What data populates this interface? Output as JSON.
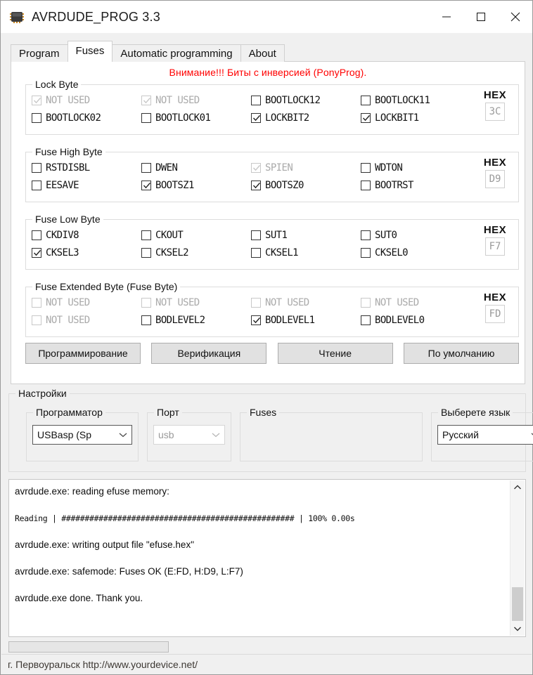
{
  "window": {
    "title": "AVRDUDE_PROG 3.3",
    "icon": "chip-icon",
    "minimize": "minimize-icon",
    "maximize": "maximize-icon",
    "close": "close-icon"
  },
  "tabs": [
    {
      "label": "Program",
      "active": false
    },
    {
      "label": "Fuses",
      "active": true
    },
    {
      "label": "Automatic programming",
      "active": false
    },
    {
      "label": "About",
      "active": false
    }
  ],
  "warning": {
    "text": "Внимание!!! Биты с инверсией (PonyProg).",
    "color": "#ff0000"
  },
  "fuse_groups": [
    {
      "title": "Lock Byte",
      "hex_label": "HEX",
      "hex_value": "3C",
      "rows": [
        [
          {
            "label": "NOT USED",
            "checked": true,
            "disabled": true
          },
          {
            "label": "NOT USED",
            "checked": true,
            "disabled": true
          },
          {
            "label": "BOOTLOCK12",
            "checked": false,
            "disabled": false
          },
          {
            "label": "BOOTLOCK11",
            "checked": false,
            "disabled": false
          }
        ],
        [
          {
            "label": "BOOTLOCK02",
            "checked": false,
            "disabled": false
          },
          {
            "label": "BOOTLOCK01",
            "checked": false,
            "disabled": false
          },
          {
            "label": "LOCKBIT2",
            "checked": true,
            "disabled": false
          },
          {
            "label": "LOCKBIT1",
            "checked": true,
            "disabled": false
          }
        ]
      ]
    },
    {
      "title": "Fuse High Byte",
      "hex_label": "HEX",
      "hex_value": "D9",
      "rows": [
        [
          {
            "label": "RSTDISBL",
            "checked": false,
            "disabled": false
          },
          {
            "label": "DWEN",
            "checked": false,
            "disabled": false
          },
          {
            "label": "SPIEN",
            "checked": true,
            "disabled": true
          },
          {
            "label": "WDTON",
            "checked": false,
            "disabled": false
          }
        ],
        [
          {
            "label": "EESAVE",
            "checked": false,
            "disabled": false
          },
          {
            "label": "BOOTSZ1",
            "checked": true,
            "disabled": false
          },
          {
            "label": "BOOTSZ0",
            "checked": true,
            "disabled": false
          },
          {
            "label": "BOOTRST",
            "checked": false,
            "disabled": false
          }
        ]
      ]
    },
    {
      "title": "Fuse Low Byte",
      "hex_label": "HEX",
      "hex_value": "F7",
      "rows": [
        [
          {
            "label": "CKDIV8",
            "checked": false,
            "disabled": false
          },
          {
            "label": "CKOUT",
            "checked": false,
            "disabled": false
          },
          {
            "label": "SUT1",
            "checked": false,
            "disabled": false
          },
          {
            "label": "SUT0",
            "checked": false,
            "disabled": false
          }
        ],
        [
          {
            "label": "CKSEL3",
            "checked": true,
            "disabled": false
          },
          {
            "label": "CKSEL2",
            "checked": false,
            "disabled": false
          },
          {
            "label": "CKSEL1",
            "checked": false,
            "disabled": false
          },
          {
            "label": "CKSEL0",
            "checked": false,
            "disabled": false
          }
        ]
      ]
    },
    {
      "title": "Fuse Extended Byte (Fuse Byte)",
      "hex_label": "HEX",
      "hex_value": "FD",
      "rows": [
        [
          {
            "label": "NOT USED",
            "checked": false,
            "disabled": true
          },
          {
            "label": "NOT USED",
            "checked": false,
            "disabled": true
          },
          {
            "label": "NOT USED",
            "checked": false,
            "disabled": true
          },
          {
            "label": "NOT USED",
            "checked": false,
            "disabled": true
          }
        ],
        [
          {
            "label": "NOT USED",
            "checked": false,
            "disabled": true
          },
          {
            "label": "BODLEVEL2",
            "checked": false,
            "disabled": false
          },
          {
            "label": "BODLEVEL1",
            "checked": true,
            "disabled": false
          },
          {
            "label": "BODLEVEL0",
            "checked": false,
            "disabled": false
          }
        ]
      ]
    }
  ],
  "actions": [
    {
      "label": "Программирование"
    },
    {
      "label": "Верификация"
    },
    {
      "label": "Чтение"
    },
    {
      "label": "По умолчанию"
    }
  ],
  "settings": {
    "title": "Настройки",
    "programmer": {
      "title": "Программатор",
      "value": "USBasp (Sp",
      "disabled": false
    },
    "port": {
      "title": "Порт",
      "value": "usb",
      "disabled": true
    },
    "fuses": {
      "title": "Fuses",
      "value": ""
    },
    "language": {
      "title": "Выберете язык",
      "value": "Русский",
      "disabled": false
    }
  },
  "log": {
    "lines": [
      "avrdude.exe: reading efuse memory:",
      "Reading | ################################################## | 100% 0.00s",
      "avrdude.exe: writing output file \"efuse.hex\"",
      "avrdude.exe: safemode: Fuses OK (E:FD, H:D9, L:F7)",
      "avrdude.exe done.  Thank you."
    ],
    "scroll_up": "scroll-up-icon",
    "scroll_down": "scroll-down-icon"
  },
  "progress": {
    "percent": 0
  },
  "statusbar": {
    "text": "г. Первоуральск   http://www.yourdevice.net/"
  }
}
